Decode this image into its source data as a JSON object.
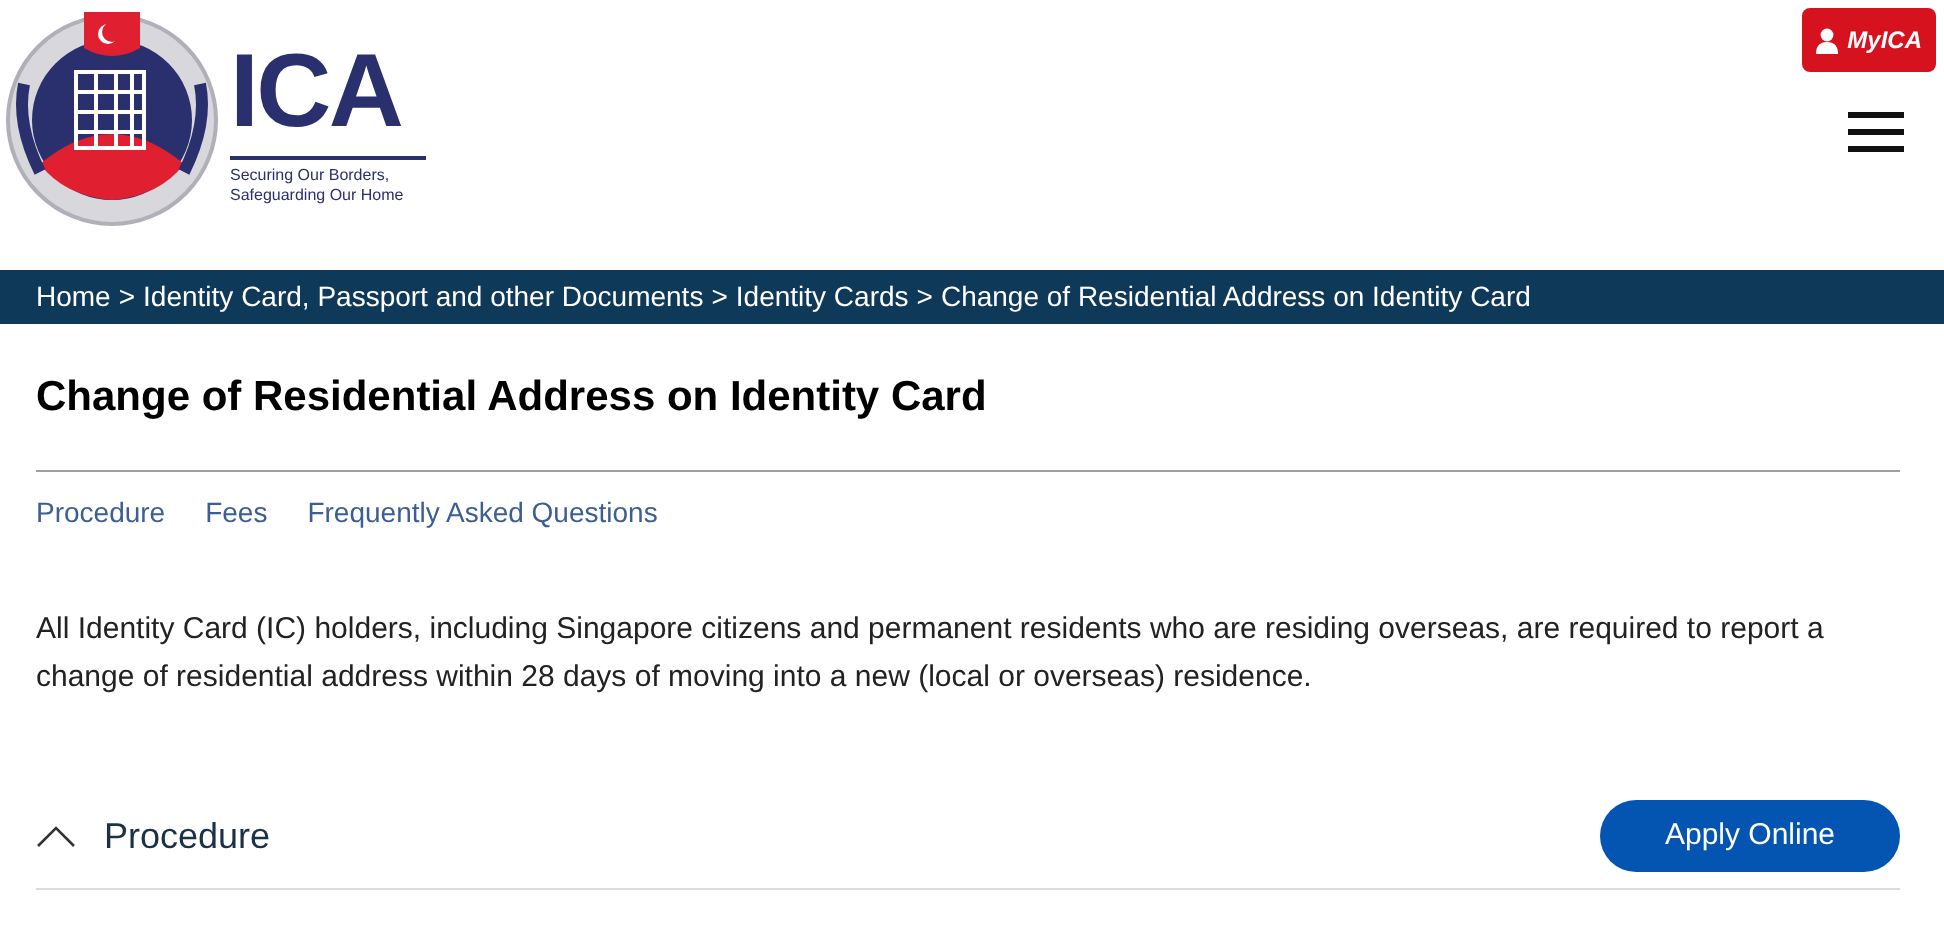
{
  "header": {
    "logo": {
      "wordmark": "ICA",
      "tagline_1": "Securing Our Borders,",
      "tagline_2": "Safeguarding Our Home"
    },
    "login_button": "MyICA"
  },
  "breadcrumb": [
    "Home",
    "Identity Card, Passport and other Documents",
    "Identity Cards",
    "Change of Residential Address on Identity Card"
  ],
  "breadcrumb_separator": ">",
  "page_title": "Change of Residential Address on Identity Card",
  "section_links": [
    "Procedure",
    "Fees",
    "Frequently Asked Questions"
  ],
  "intro": "All Identity Card (IC) holders, including Singapore citizens and permanent residents who are residing overseas, are required to report a change of residential address within 28 days of moving into a new (local or overseas) residence.",
  "accordion": [
    {
      "title": "Procedure",
      "expanded": true,
      "action": "Apply Online"
    }
  ]
}
